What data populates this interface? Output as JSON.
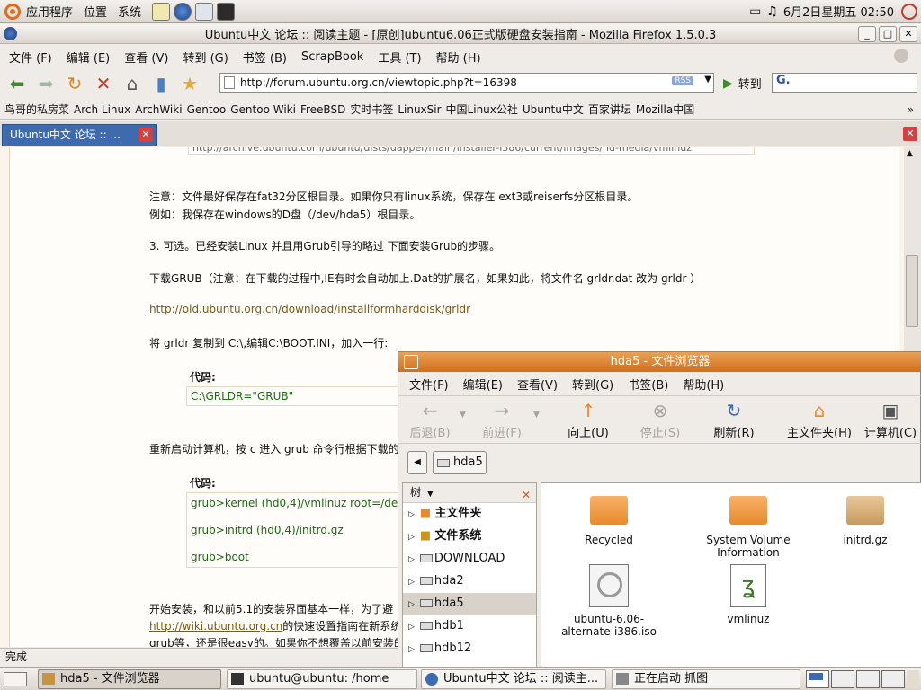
{
  "top_panel": {
    "menus": [
      "应用程序",
      "位置",
      "系统"
    ],
    "clock": "6月2日星期五  02:50"
  },
  "firefox": {
    "title": "Ubuntu中文 论坛 :: 阅读主题 - [原创]ubuntu6.06正式版硬盘安装指南 - Mozilla Firefox 1.5.0.3",
    "menu": [
      "文件 (F)",
      "编辑 (E)",
      "查看 (V)",
      "转到 (G)",
      "书签 (B)",
      "ScrapBook",
      "工具 (T)",
      "帮助 (H)"
    ],
    "url": "http://forum.ubuntu.org.cn/viewtopic.php?t=16398",
    "rss": "RSS",
    "go_label": "转到",
    "search_prefix": "G.",
    "bookmarks": [
      "鸟哥的私房菜",
      "Arch Linux",
      "ArchWiki",
      "Gentoo",
      "Gentoo Wiki",
      "FreeBSD",
      "实时书签",
      "LinuxSir",
      "中国Linux公社",
      "Ubuntu中文",
      "百家讲坛",
      "Mozilla中国"
    ],
    "bookmarks_more": "»",
    "tab_label": "Ubuntu中文 论坛 :: ...",
    "status": "完成"
  },
  "page": {
    "cut_line": "http://archive.ubuntu.com/ubuntu/dists/dapper/main/installer-i386/current/images/hd-media/vmlinuz",
    "note1": "注意：文件最好保存在fat32分区根目录。如果你只有linux系统，保存在 ext3或reiserfs分区根目录。",
    "note2": "例如：我保存在windows的D盘（/dev/hda5）根目录。",
    "step3": "3. 可选。已经安装Linux 并且用Grub引导的略过 下面安装Grub的步骤。",
    "download_grub": "下载GRUB（注意：在下载的过程中,IE有时会自动加上.Dat的扩展名，如果如此，将文件名 grldr.dat 改为 grldr ）",
    "link1": "http://old.ubuntu.org.cn/download/installformharddisk/grldr",
    "copy_grldr": "将 grldr 复制到 C:\\,编辑C:\\BOOT.INI，加入一行:",
    "code_label": "代码:",
    "code1": "C:\\GRLDR=\"GRUB\"",
    "reboot": "重新启动计算机，按 c 进入 grub 命令行根据下载的",
    "code_label2": "代码:",
    "code2": [
      "grub>kernel (hd0,4)/vmlinuz root=/de",
      "grub>initrd (hd0,4)/initrd.gz",
      "grub>boot"
    ],
    "install1": "开始安装，和以前5.1的安装界面基本一样，为了避",
    "link2": "http://wiki.ubuntu.org.cn",
    "install2": "的快速设置指南在新系统",
    "install3": "grub等，还是很easy的。如果你不想覆盖以前安装的"
  },
  "file_browser": {
    "title": "hda5 - 文件浏览器",
    "menu": [
      "文件(F)",
      "编辑(E)",
      "查看(V)",
      "转到(G)",
      "书签(B)",
      "帮助(H)"
    ],
    "toolbar": {
      "back": "后退(B)",
      "forward": "前进(F)",
      "up": "向上(U)",
      "stop": "停止(S)",
      "reload": "刷新(R)",
      "home": "主文件夹(H)",
      "computer": "计算机(C)"
    },
    "location": "hda5",
    "sidebar_title": "树",
    "tree": [
      "主文件夹",
      "文件系统",
      "DOWNLOAD",
      "hda2",
      "hda5",
      "hdb1",
      "hdb12"
    ],
    "files": [
      {
        "name": "Recycled",
        "icon": "folder-icon"
      },
      {
        "name": "System Volume Information",
        "icon": "folder-icon"
      },
      {
        "name": "initrd.gz",
        "icon": "package-icon"
      },
      {
        "name": "ubuntu-6.06-alternate-i386.iso",
        "icon": "disc-image-icon"
      },
      {
        "name": "vmlinuz",
        "icon": "gnome-file-icon"
      }
    ]
  },
  "bottom_panel": {
    "tasks": [
      "hda5 - 文件浏览器",
      "ubuntu@ubuntu: /home",
      "Ubuntu中文 论坛 :: 阅读主...",
      "正在启动 抓图"
    ]
  }
}
